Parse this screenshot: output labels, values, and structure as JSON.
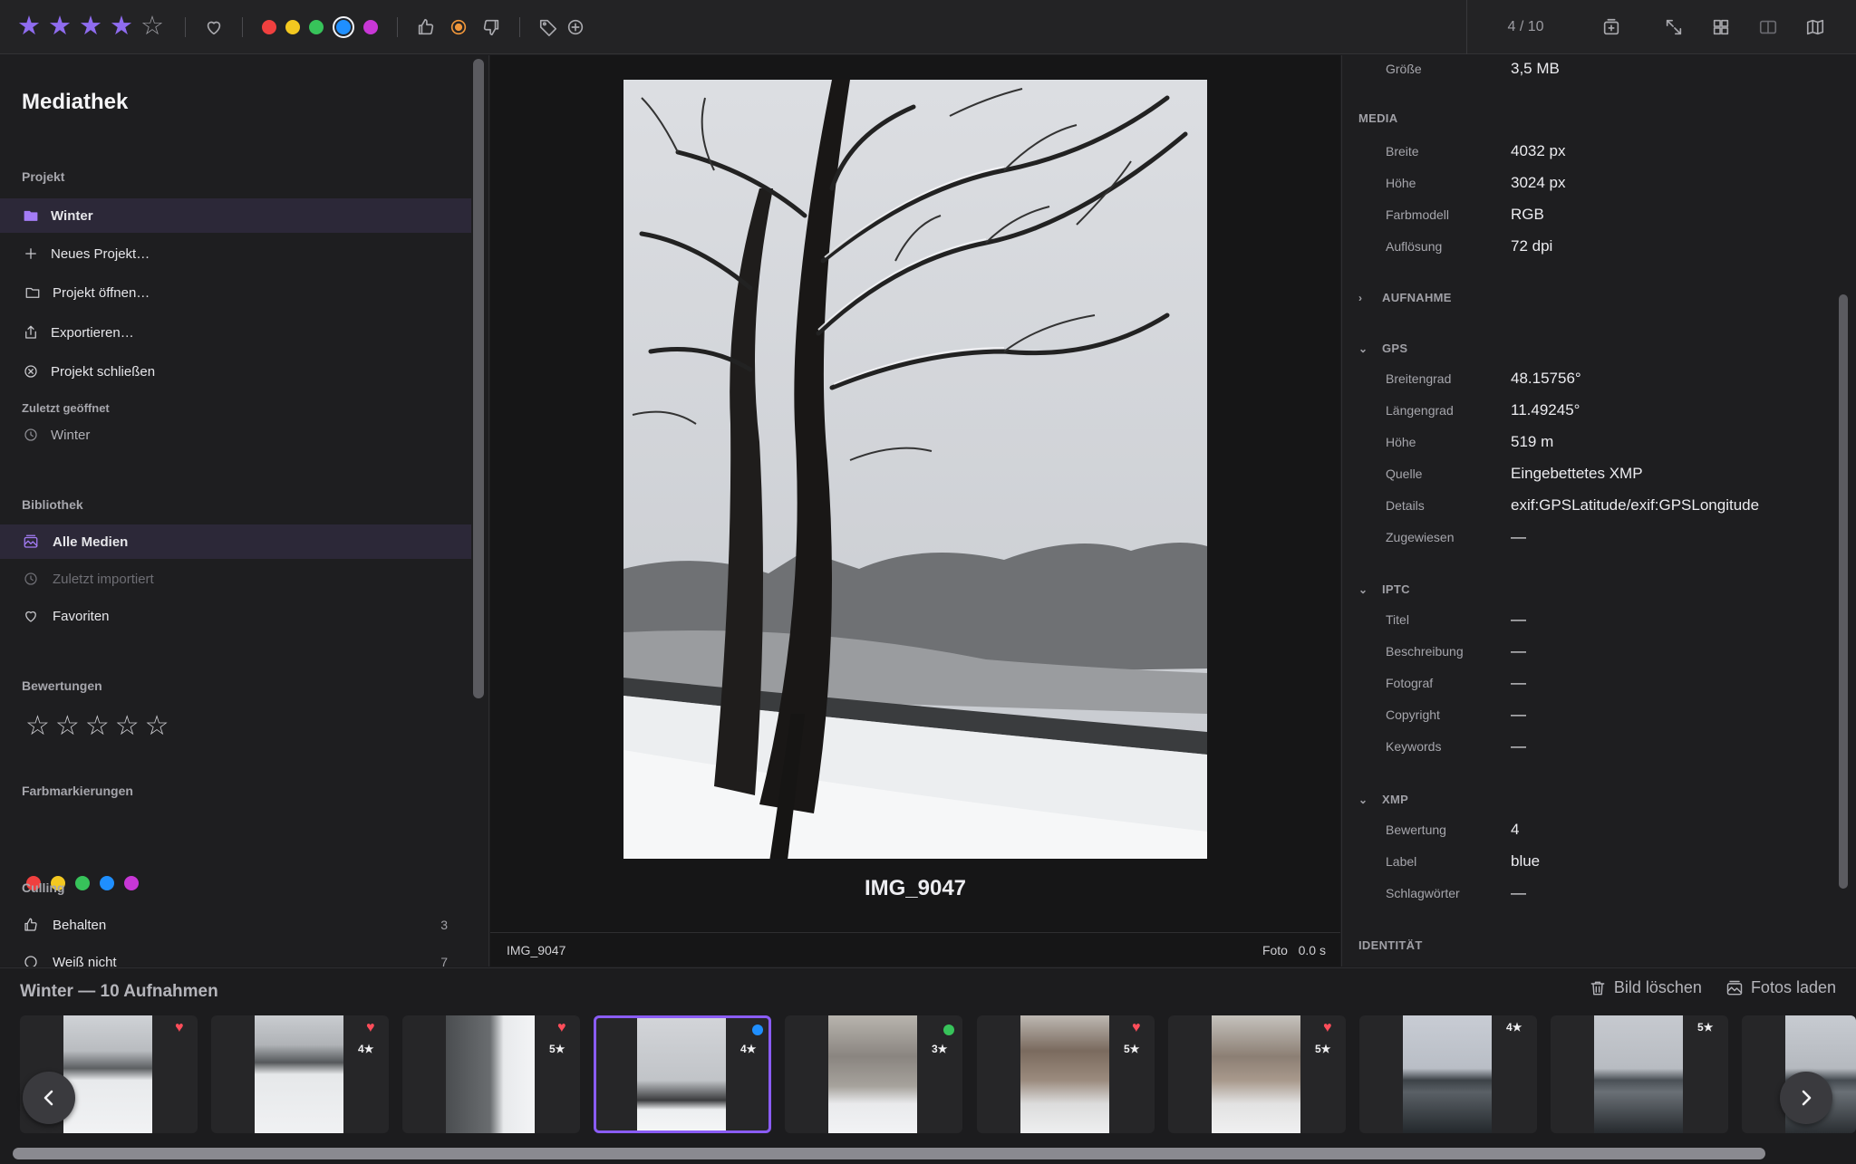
{
  "toolbar": {
    "rating": 4,
    "max_rating": 5,
    "color_labels": [
      "#f0403f",
      "#f3c820",
      "#37c35a",
      "#1f8fff",
      "#c837d6"
    ],
    "selected_color": "blue",
    "counter": "4 / 10"
  },
  "sidebar": {
    "title": "Mediathek",
    "project_section": "Projekt",
    "project_items": [
      {
        "label": "Winter",
        "icon": "folder-icon",
        "active": true
      },
      {
        "label": "Neues Projekt…",
        "icon": "plus-icon"
      },
      {
        "label": "Projekt öffnen…",
        "icon": "folder-open-icon"
      },
      {
        "label": "Exportieren…",
        "icon": "export-icon"
      },
      {
        "label": "Projekt schließen",
        "icon": "close-circle-icon"
      }
    ],
    "recent_section": "Zuletzt geöffnet",
    "recent_items": [
      {
        "label": "Winter",
        "icon": "clock-icon"
      }
    ],
    "library_section": "Bibliothek",
    "library_items": [
      {
        "label": "Alle Medien",
        "icon": "photos-icon",
        "active": true
      },
      {
        "label": "Zuletzt importiert",
        "icon": "clock-icon",
        "disabled": true
      },
      {
        "label": "Favoriten",
        "icon": "heart-icon"
      }
    ],
    "ratings_section": "Bewertungen",
    "colors_section": "Farbmarkierungen",
    "color_dots": [
      "#f0403f",
      "#f3c820",
      "#37c35a",
      "#1f8fff",
      "#c837d6"
    ],
    "culling_section": "Culling",
    "culling_items": [
      {
        "label": "Behalten",
        "count": "3",
        "icon": "thumbs-up-icon"
      },
      {
        "label": "Weiß nicht",
        "count": "7",
        "icon": "circle-icon"
      }
    ]
  },
  "viewer": {
    "caption": "IMG_9047",
    "status_name": "IMG_9047",
    "status_right": "Foto   0.0 s"
  },
  "inspector": {
    "size_label": "Größe",
    "size_value": "3,5 MB",
    "media_heading": "MEDIA",
    "media": [
      {
        "k": "Breite",
        "v": "4032 px"
      },
      {
        "k": "Höhe",
        "v": "3024 px"
      },
      {
        "k": "Farbmodell",
        "v": "RGB"
      },
      {
        "k": "Auflösung",
        "v": "72 dpi"
      }
    ],
    "aufnahme_heading": "AUFNAHME",
    "gps_heading": "GPS",
    "gps": [
      {
        "k": "Breitengrad",
        "v": "48.15756°"
      },
      {
        "k": "Längengrad",
        "v": "11.49245°"
      },
      {
        "k": "Höhe",
        "v": "519 m"
      },
      {
        "k": "Quelle",
        "v": "Eingebettetes XMP"
      },
      {
        "k": "Details",
        "v": "exif:GPSLatitude/exif:GPSLongitude"
      },
      {
        "k": "Zugewiesen",
        "v": "—"
      }
    ],
    "iptc_heading": "IPTC",
    "iptc": [
      {
        "k": "Titel",
        "v": "—"
      },
      {
        "k": "Beschreibung",
        "v": "—"
      },
      {
        "k": "Fotograf",
        "v": "—"
      },
      {
        "k": "Copyright",
        "v": "—"
      },
      {
        "k": "Keywords",
        "v": "—"
      }
    ],
    "xmp_heading": "XMP",
    "xmp": [
      {
        "k": "Bewertung",
        "v": "4"
      },
      {
        "k": "Label",
        "v": "blue"
      },
      {
        "k": "Schlagwörter",
        "v": "—"
      }
    ],
    "identity_heading": "IDENTITÄT"
  },
  "filmstrip": {
    "title": "Winter — 10 Aufnahmen",
    "delete_label": "Bild löschen",
    "load_label": "Fotos laden",
    "thumbs": [
      {
        "heart": true,
        "badge": "",
        "dot": ""
      },
      {
        "heart": true,
        "badge": "4★",
        "dot": ""
      },
      {
        "heart": true,
        "badge": "5★",
        "dot": ""
      },
      {
        "heart": false,
        "badge": "4★",
        "dot": "#1f8fff",
        "selected": true
      },
      {
        "heart": false,
        "badge": "3★",
        "dot": "#37c35a"
      },
      {
        "heart": true,
        "badge": "5★",
        "dot": ""
      },
      {
        "heart": true,
        "badge": "5★",
        "dot": ""
      },
      {
        "heart": false,
        "badge": "4★",
        "dot": ""
      },
      {
        "heart": false,
        "badge": "5★",
        "dot": ""
      },
      {
        "heart": false,
        "badge": "",
        "dot": ""
      }
    ]
  }
}
